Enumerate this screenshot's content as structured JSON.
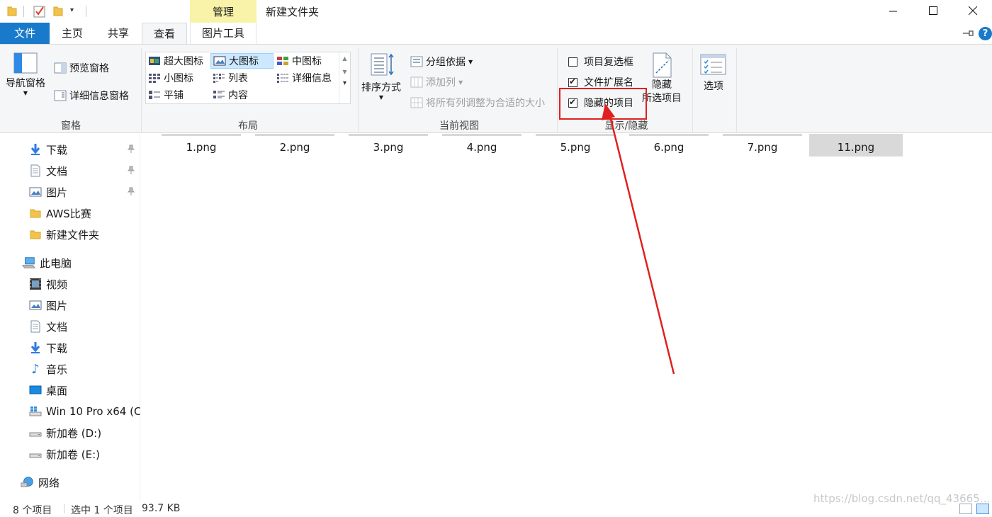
{
  "window": {
    "title": "新建文件夹",
    "context_tab": "管理"
  },
  "tabs": {
    "file": "文件",
    "home": "主页",
    "share": "共享",
    "view": "查看",
    "picture_tools": "图片工具"
  },
  "ribbon": {
    "panes": {
      "nav_pane": "导航窗格",
      "preview_pane": "预览窗格",
      "details_pane": "详细信息窗格",
      "label": "窗格"
    },
    "layout": {
      "items": [
        "超大图标",
        "大图标",
        "中图标",
        "小图标",
        "列表",
        "详细信息",
        "平铺",
        "内容"
      ],
      "selected": "大图标",
      "label": "布局"
    },
    "current_view": {
      "sort_by": "排序方式",
      "group_by": "分组依据",
      "add_column": "添加列",
      "size_all_columns": "将所有列调整为合适的大小",
      "label": "当前视图"
    },
    "show_hide": {
      "item_checkboxes": "项目复选框",
      "item_checkboxes_checked": false,
      "file_extensions": "文件扩展名",
      "file_extensions_checked": true,
      "hidden_items": "隐藏的项目",
      "hidden_items_checked": true,
      "hide_selected_line1": "隐藏",
      "hide_selected_line2": "所选项目",
      "label": "显示/隐藏"
    },
    "options": "选项"
  },
  "nav": {
    "quick_access": [
      {
        "label": "下载",
        "icon": "download-arrow-icon",
        "pinned": true
      },
      {
        "label": "文档",
        "icon": "document-icon",
        "pinned": true
      },
      {
        "label": "图片",
        "icon": "pictures-icon",
        "pinned": true
      },
      {
        "label": "AWS比赛",
        "icon": "folder-icon",
        "pinned": false
      },
      {
        "label": "新建文件夹",
        "icon": "folder-icon",
        "pinned": false
      }
    ],
    "this_pc": "此电脑",
    "pc_items": [
      {
        "label": "视频",
        "icon": "video-icon"
      },
      {
        "label": "图片",
        "icon": "pictures-icon"
      },
      {
        "label": "文档",
        "icon": "document-icon"
      },
      {
        "label": "下载",
        "icon": "download-arrow-icon"
      },
      {
        "label": "音乐",
        "icon": "music-note-icon"
      },
      {
        "label": "桌面",
        "icon": "desktop-icon"
      },
      {
        "label": "Win 10 Pro x64 (C:",
        "icon": "windows-drive-icon"
      },
      {
        "label": "新加卷 (D:)",
        "icon": "drive-icon"
      },
      {
        "label": "新加卷 (E:)",
        "icon": "drive-icon"
      }
    ],
    "network": "网络"
  },
  "files": [
    "1.png",
    "2.png",
    "3.png",
    "4.png",
    "5.png",
    "6.png",
    "7.png",
    "11.png"
  ],
  "selected_file": "11.png",
  "status": {
    "count": "8 个项目",
    "selected": "选中 1 个项目",
    "size": "93.7 KB"
  },
  "watermark": "https://blog.csdn.net/qq_43665…",
  "colors": {
    "accent": "#1979ca",
    "manage_tab": "#f8f3a8",
    "highlight": "#e02020",
    "selected_item": "#d9d9d9"
  }
}
